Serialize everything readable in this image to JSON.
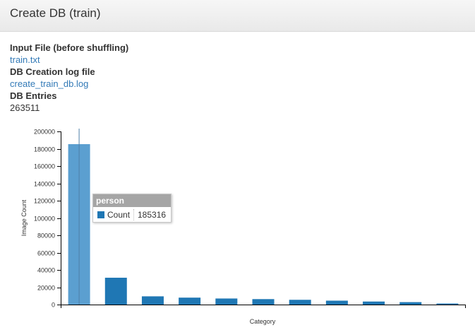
{
  "header": {
    "title": "Create DB (train)"
  },
  "info": {
    "input_file_label": "Input File (before shuffling)",
    "input_file_link": "train.txt",
    "log_label": "DB Creation log file",
    "log_link": "create_train_db.log",
    "entries_label": "DB Entries",
    "entries_value": "263511"
  },
  "tooltip": {
    "category": "person",
    "series_name": "Count",
    "value": "185316"
  },
  "colors": {
    "bar": "#1f77b4",
    "bar_hover": "#5b9fd0",
    "link": "#337ab7"
  },
  "chart_data": {
    "type": "bar",
    "xlabel": "Category",
    "ylabel": "Image Count",
    "ylim": [
      0,
      200000
    ],
    "yticks": [
      0,
      20000,
      40000,
      60000,
      80000,
      100000,
      120000,
      140000,
      160000,
      180000,
      200000
    ],
    "ytick_labels": [
      "0",
      "20000",
      "40000",
      "60000",
      "80000",
      "100000",
      "120000",
      "140000",
      "160000",
      "180000",
      "200000"
    ],
    "categories": [
      "person",
      "",
      "",
      "",
      "",
      "",
      "",
      "",
      "",
      "",
      ""
    ],
    "values": [
      185316,
      31000,
      9500,
      8000,
      7000,
      6300,
      5500,
      4500,
      3500,
      2800,
      1200
    ],
    "highlighted_index": 0,
    "grid": false
  }
}
